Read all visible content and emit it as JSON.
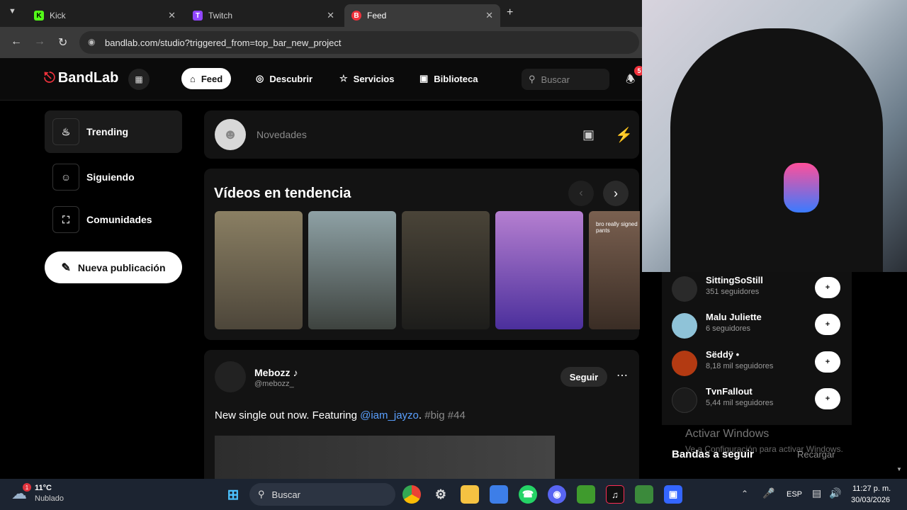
{
  "browser": {
    "tabs": [
      {
        "label": "Kick",
        "favicon": "K",
        "color": "#53fc18"
      },
      {
        "label": "Twitch",
        "favicon": "T",
        "color": "#9146ff"
      },
      {
        "label": "Feed",
        "favicon": "B",
        "color": "#f0323c"
      }
    ],
    "url": "bandlab.com/studio?triggered_from=top_bar_new_project"
  },
  "header": {
    "logo": "BandLab",
    "nav": [
      {
        "label": "Feed",
        "icon": "home-icon"
      },
      {
        "label": "Descubrir",
        "icon": "compass-icon"
      },
      {
        "label": "Servicios",
        "icon": "star-icon"
      },
      {
        "label": "Biblioteca",
        "icon": "library-icon"
      }
    ],
    "search_placeholder": "Buscar",
    "notification_count": "5"
  },
  "sidebar": {
    "items": [
      {
        "label": "Trending",
        "icon": "flame-icon"
      },
      {
        "label": "Siguiendo",
        "icon": "people-icon"
      },
      {
        "label": "Comunidades",
        "icon": "community-icon"
      }
    ],
    "new_post": "Nueva publicación"
  },
  "composer": {
    "placeholder": "Novedades"
  },
  "trending": {
    "title": "Vídeos en tendencia",
    "thumbs": [
      {
        "color": "#6b6150"
      },
      {
        "color": "#525c58"
      },
      {
        "color": "#33302b"
      },
      {
        "color": "#6b52b3"
      },
      {
        "color": "#5a4535"
      }
    ],
    "thumb5_caption": "bro really signed pants"
  },
  "post": {
    "author": "Mebozz ♪",
    "handle": "@mebozz_",
    "follow": "Seguir",
    "text_plain": "New single out now. Featuring ",
    "mention": "@iam_jayzo",
    "period": ".",
    "tags": "#big #44"
  },
  "suggestions": [
    {
      "name": "SittingSoStill",
      "followers": "351 seguidores",
      "color": "#2a2a2a"
    },
    {
      "name": "Malu Juliette",
      "followers": "6 seguidores",
      "color": "#8fc3d8"
    },
    {
      "name": "Sëddÿ •",
      "followers": "8,18 mil seguidores",
      "color": "#b33a12"
    },
    {
      "name": "TvnFallout",
      "followers": "5,44 mil seguidores",
      "color": "#1b1b1b"
    }
  ],
  "follow_plus": "+",
  "bands_title": "Bandas a seguir",
  "reload": "Recargar",
  "watermark": {
    "title": "Activar Windows",
    "sub": "Ve a Configuración para activar Windows."
  },
  "taskbar": {
    "weather_temp": "11°C",
    "weather_desc": "Nublado",
    "search": "Buscar",
    "lang": "ESP",
    "time": "11:27 p. m.",
    "date": "30/03/2026"
  }
}
